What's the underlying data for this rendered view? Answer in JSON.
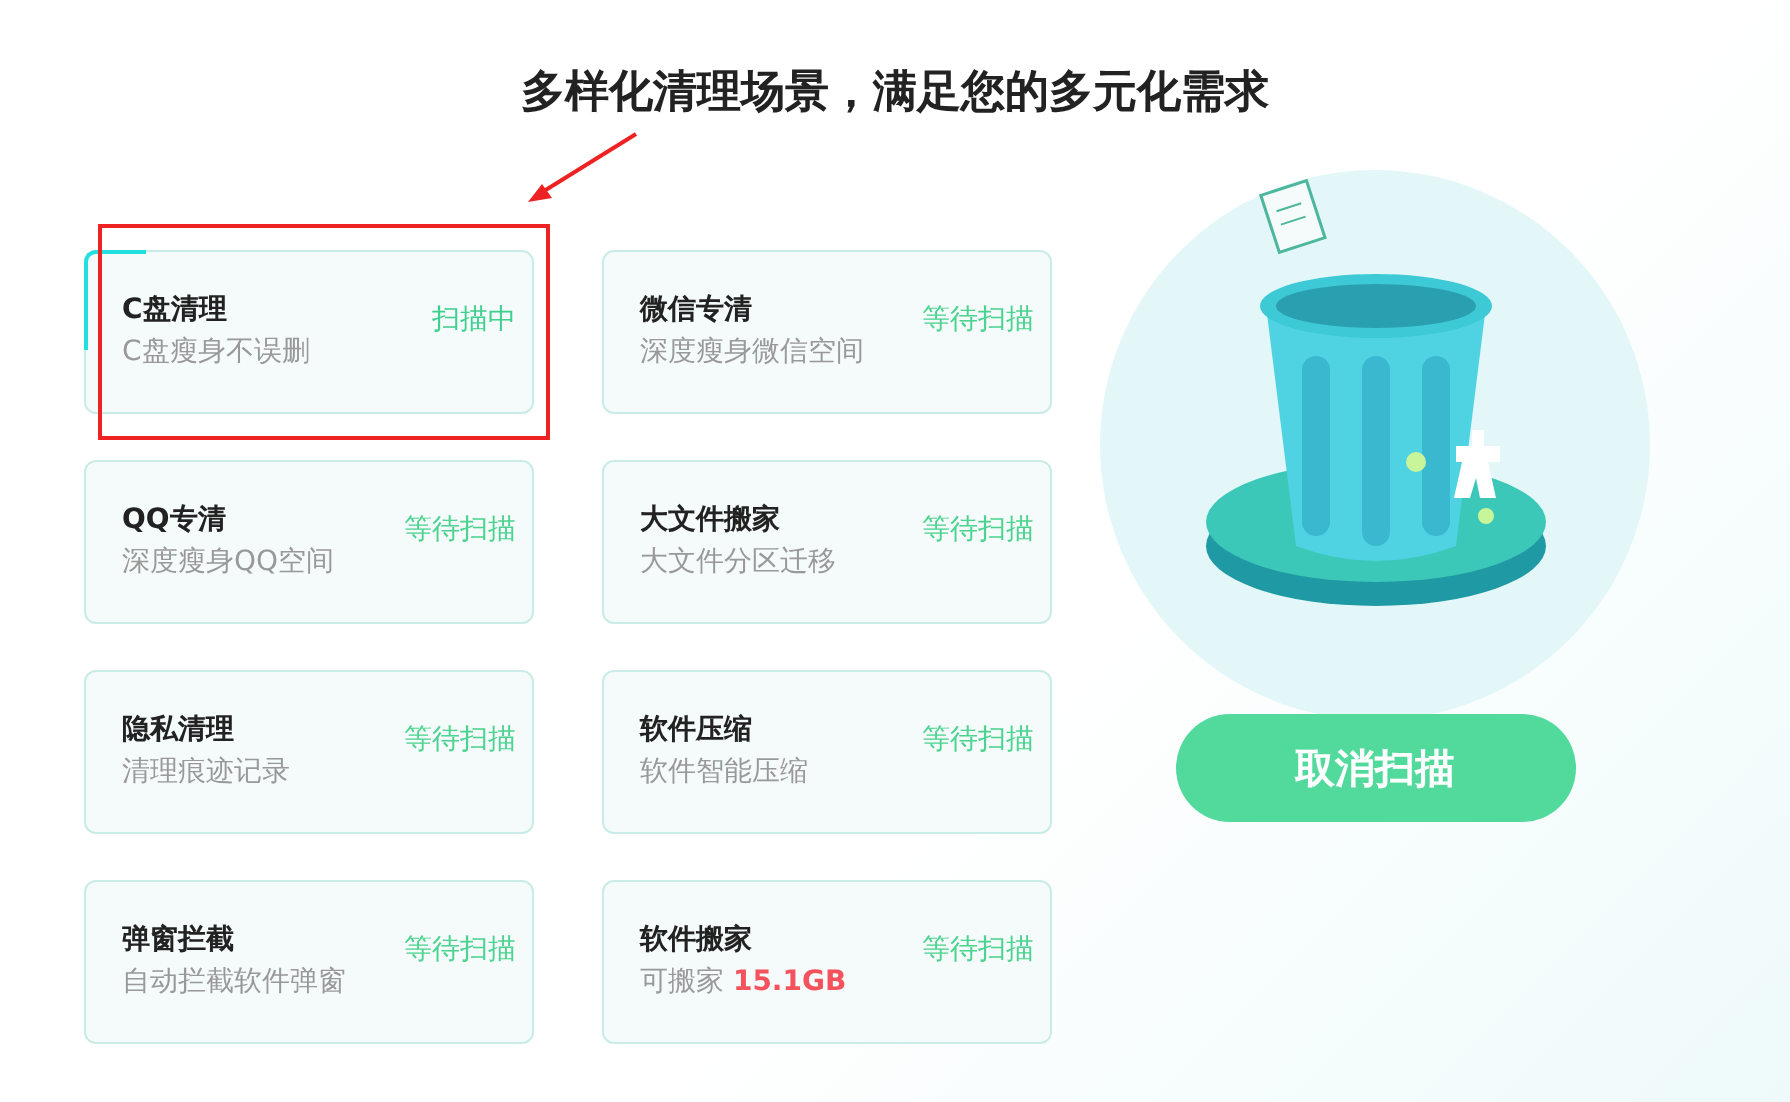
{
  "title": "多样化清理场景，满足您的多元化需求",
  "cards": [
    {
      "title": "C盘清理",
      "subtitle": "C盘瘦身不误删",
      "status": "扫描中",
      "scanning": true,
      "highlighted": true
    },
    {
      "title": "微信专清",
      "subtitle": "深度瘦身微信空间",
      "status": "等待扫描",
      "scanning": false,
      "highlighted": false
    },
    {
      "title": "QQ专清",
      "subtitle": "深度瘦身QQ空间",
      "status": "等待扫描",
      "scanning": false,
      "highlighted": false
    },
    {
      "title": "大文件搬家",
      "subtitle": "大文件分区迁移",
      "status": "等待扫描",
      "scanning": false,
      "highlighted": false
    },
    {
      "title": "隐私清理",
      "subtitle": "清理痕迹记录",
      "status": "等待扫描",
      "scanning": false,
      "highlighted": false
    },
    {
      "title": "软件压缩",
      "subtitle": "软件智能压缩",
      "status": "等待扫描",
      "scanning": false,
      "highlighted": false
    },
    {
      "title": "弹窗拦截",
      "subtitle": "自动拦截软件弹窗",
      "status": "等待扫描",
      "scanning": false,
      "highlighted": false
    },
    {
      "title": "软件搬家",
      "subtitle": "可搬家 **15.1GB**",
      "status": "等待扫描",
      "scanning": false,
      "highlighted": false
    }
  ],
  "cancel_button": "取消扫描"
}
